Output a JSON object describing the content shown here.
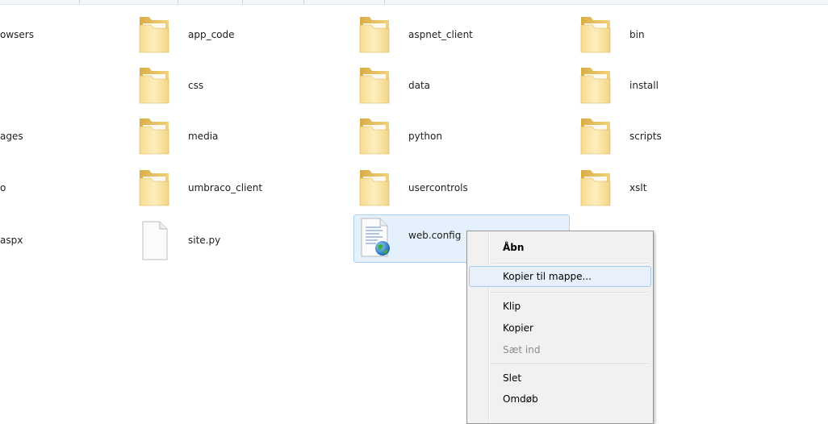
{
  "cut_off_labels": [
    "owsers",
    "ages",
    "o",
    "aspx"
  ],
  "items": [
    {
      "label": "app_code",
      "type": "folder"
    },
    {
      "label": "aspnet_client",
      "type": "folder"
    },
    {
      "label": "bin",
      "type": "folder"
    },
    {
      "label": "css",
      "type": "folder"
    },
    {
      "label": "data",
      "type": "folder"
    },
    {
      "label": "install",
      "type": "folder"
    },
    {
      "label": "media",
      "type": "folder"
    },
    {
      "label": "python",
      "type": "folder"
    },
    {
      "label": "scripts",
      "type": "folder"
    },
    {
      "label": "umbraco_client",
      "type": "folder"
    },
    {
      "label": "usercontrols",
      "type": "folder"
    },
    {
      "label": "xslt",
      "type": "folder"
    },
    {
      "label": "site.py",
      "type": "file"
    },
    {
      "label": "web.config",
      "type": "config-file"
    }
  ],
  "context_menu": {
    "items": [
      {
        "label": "Åbn",
        "bold": true
      },
      {
        "label": "Kopier til mappe...",
        "highlighted": true
      },
      {
        "label": "Klip"
      },
      {
        "label": "Kopier"
      },
      {
        "label": "Sæt ind",
        "disabled": true
      },
      {
        "label": "Slet"
      },
      {
        "label": "Omdøb"
      }
    ]
  },
  "colors": {
    "selection_bg": "#e4f0fb",
    "selection_border": "#a9d1f2",
    "folder_light": "#fce7a3",
    "folder_dark": "#e3be5a",
    "menu_bg": "#f1f1f1",
    "menu_hover": "#e8f1fb"
  }
}
